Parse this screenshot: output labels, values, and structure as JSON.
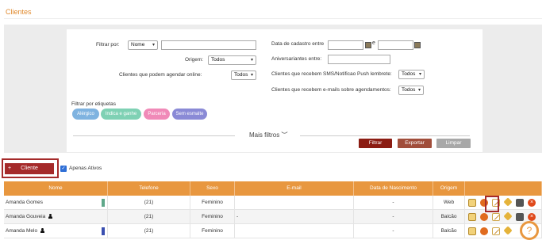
{
  "page": {
    "title": "Clientes"
  },
  "filters": {
    "filtrar_por_label": "Filtrar por:",
    "filtrar_por_value": "Nome",
    "origem_label": "Origem:",
    "origem_value": "Todos",
    "agendar_label": "Clientes que podem agendar online:",
    "agendar_value": "Todos",
    "cadastro_label": "Data de cadastro entre",
    "date_separator": "e",
    "aniversariantes_label": "Aniversariantes entre:",
    "sms_label": "Clientes que recebem SMS/Notificao Push lembrete:",
    "sms_value": "Todos",
    "emails_label": "Clientes que recebem e-mails sobre agendamentos:",
    "emails_value": "Todos",
    "tags_label": "Filtrar por etiquetas",
    "tags": [
      {
        "label": "Alérgico",
        "color": "#7fb3e0"
      },
      {
        "label": "Indica e ganhe",
        "color": "#7fd1b4"
      },
      {
        "label": "Parceria",
        "color": "#f08ab8"
      },
      {
        "label": "Sem esmalte",
        "color": "#8a8ad6"
      }
    ],
    "mais_filtros": "Mais filtros",
    "mais_filtros_icon": "chevron-down-icon",
    "buttons": {
      "filtrar": "Filtrar",
      "exportar": "Exportar",
      "limpar": "Limpar"
    }
  },
  "actions": {
    "add_client": "Cliente",
    "add_icon": "+",
    "apenas_ativos": "Apenas Ativos",
    "apenas_ativos_checked": true
  },
  "table": {
    "columns": [
      "Nome",
      "Telefone",
      "Sexo",
      "E-mail",
      "Data de Nascimento",
      "Origem",
      ""
    ],
    "rows": [
      {
        "nome": "Amanda Gomes",
        "telefone": "(21)",
        "sexo": "Feminino",
        "email": "",
        "nascimento": "-",
        "origem": "Web",
        "flag_color": "#5fa88a"
      },
      {
        "nome": "Amanda Gouveia",
        "telefone": "(21)",
        "sexo": "Feminino",
        "email": "-",
        "nascimento": "-",
        "origem": "Balcão",
        "flag_color": ""
      },
      {
        "nome": "Amanda Melo",
        "telefone": "(21)",
        "sexo": "Feminino",
        "email": "",
        "nascimento": "-",
        "origem": "Balcão",
        "flag_color": "#3a4fb0"
      }
    ],
    "row_icons": [
      "clipboard-icon",
      "gift-icon",
      "edit-icon",
      "money-icon",
      "camera-icon",
      "delete-icon"
    ]
  },
  "help": {
    "label": "?"
  },
  "colors": {
    "accent": "#e8973f",
    "brand_dark": "#a52a2a",
    "filter_btn": "#8b1c12",
    "export_btn": "#a14e3b",
    "clear_btn": "#a8a8a8"
  }
}
